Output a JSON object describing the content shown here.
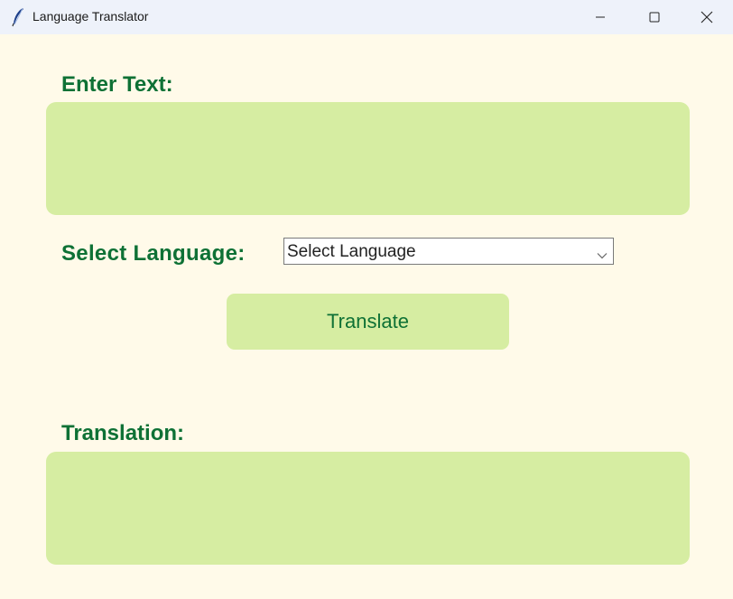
{
  "window": {
    "title": "Language Translator",
    "app_icon": "feather-icon",
    "controls": {
      "minimize_icon": "minimize-icon",
      "maximize_icon": "maximize-icon",
      "close_icon": "close-icon"
    }
  },
  "form": {
    "enter_text_label": "Enter Text:",
    "input_text": "",
    "select_language_label": "Select Language:",
    "language_selected": "Select Language",
    "translate_button_label": "Translate",
    "translation_label": "Translation:",
    "output_text": ""
  },
  "colors": {
    "background": "#fffae9",
    "accent_text": "#0e7135",
    "field_bg": "#d6eda2",
    "titlebar_bg": "#eef2fa"
  }
}
